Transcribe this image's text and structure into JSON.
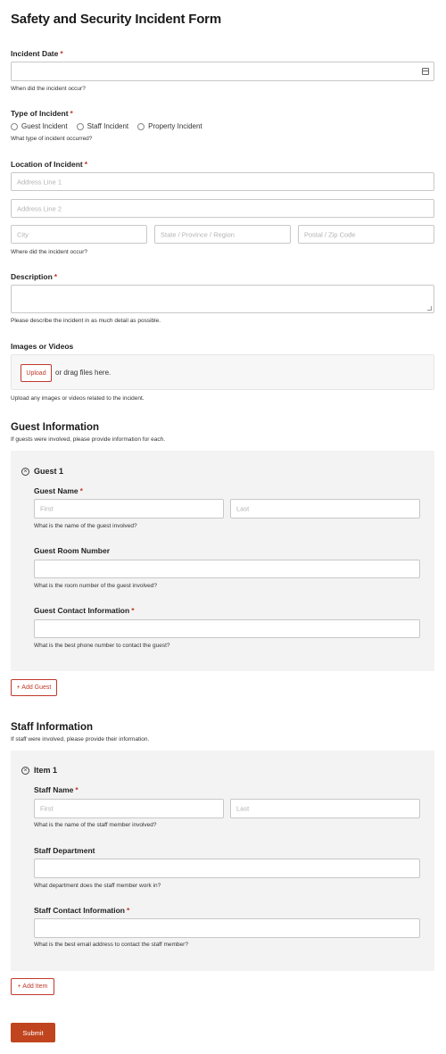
{
  "form": {
    "title": "Safety and Security Incident Form",
    "submit_label": "Submit"
  },
  "incident_date": {
    "label": "Incident Date",
    "required": "*",
    "help": "When did the incident occur?",
    "calendar_icon": "calendar-icon"
  },
  "incident_type": {
    "label": "Type of Incident",
    "required": "*",
    "options": [
      "Guest Incident",
      "Staff Incident",
      "Property Incident"
    ],
    "help": "What type of incident occurred?"
  },
  "location": {
    "label": "Location of Incident",
    "required": "*",
    "address1_placeholder": "Address Line 1",
    "address2_placeholder": "Address Line 2",
    "city_placeholder": "City",
    "state_placeholder": "State / Province / Region",
    "zip_placeholder": "Postal / Zip Code",
    "help": "Where did the incident occur?"
  },
  "description": {
    "label": "Description",
    "required": "*",
    "help": "Please describe the incident in as much detail as possible."
  },
  "media": {
    "label": "Images or Videos",
    "upload_label": "Upload",
    "drag_text": "or drag files here.",
    "help": "Upload any images or videos related to the incident."
  },
  "guest_section": {
    "title": "Guest Information",
    "subtitle": "If guests were involved, please provide information for each.",
    "item_title": "Guest 1",
    "name_label": "Guest Name",
    "name_required": "*",
    "first_placeholder": "First",
    "last_placeholder": "Last",
    "name_help": "What is the name of the guest involved?",
    "room_label": "Guest Room Number",
    "room_help": "What is the room number of the guest involved?",
    "contact_label": "Guest Contact Information",
    "contact_required": "*",
    "contact_help": "What is the best phone number to contact the guest?",
    "add_label": "+ Add Guest"
  },
  "staff_section": {
    "title": "Staff Information",
    "subtitle": "If staff were involved, please provide their information.",
    "item_title": "Item 1",
    "name_label": "Staff Name",
    "name_required": "*",
    "first_placeholder": "First",
    "last_placeholder": "Last",
    "name_help": "What is the name of the staff member involved?",
    "dept_label": "Staff Department",
    "dept_help": "What department does the staff member work in?",
    "contact_label": "Staff Contact Information",
    "contact_required": "*",
    "contact_help": "What is the best email address to contact the staff member?",
    "add_label": "+ Add Item"
  },
  "colors": {
    "accent": "#c0392b",
    "submit_bg": "#c0451e",
    "panel_bg": "#f3f3f3"
  }
}
